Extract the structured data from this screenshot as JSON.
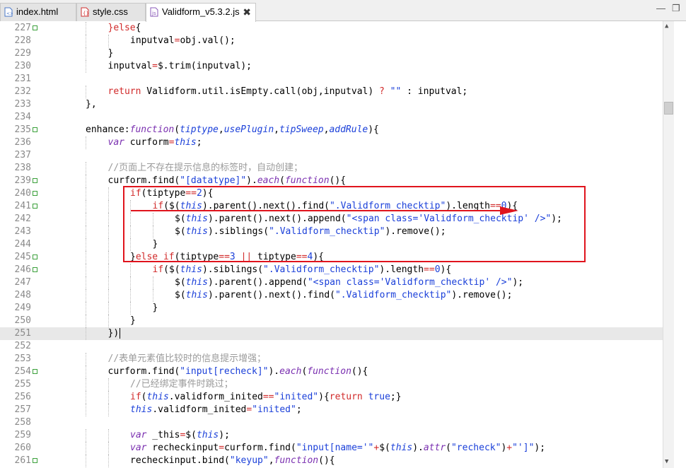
{
  "tabs": [
    {
      "label": "index.html",
      "icon": "html-file-icon"
    },
    {
      "label": "style.css",
      "icon": "css-file-icon"
    },
    {
      "label": "Validform_v5.3.2.js",
      "icon": "js-file-icon",
      "close": "✖"
    }
  ],
  "window_controls": {
    "minimize": "—",
    "restore": "❐"
  },
  "scroll": {
    "up": "▲",
    "down": "▼"
  },
  "lines": [
    {
      "n": "227",
      "fold": true,
      "indent": 3,
      "t": [
        [
          "k",
          "}else"
        ],
        [
          "p",
          "{"
        ]
      ]
    },
    {
      "n": "228",
      "indent": 4,
      "t": [
        [
          "p",
          "inputval"
        ],
        [
          "o",
          "="
        ],
        [
          "p",
          "obj.val();"
        ]
      ]
    },
    {
      "n": "229",
      "indent": 3,
      "t": [
        [
          "p",
          "}"
        ]
      ]
    },
    {
      "n": "230",
      "indent": 3,
      "t": [
        [
          "p",
          "inputval"
        ],
        [
          "o",
          "="
        ],
        [
          "p",
          "$.trim(inputval);"
        ]
      ]
    },
    {
      "n": "231",
      "indent": 0,
      "t": []
    },
    {
      "n": "232",
      "indent": 3,
      "t": [
        [
          "k",
          "return"
        ],
        [
          "p",
          " Validform.util.isEmpty.call(obj,inputval) "
        ],
        [
          "o",
          "?"
        ],
        [
          "p",
          " "
        ],
        [
          "s",
          "\"\""
        ],
        [
          "p",
          " : inputval;"
        ]
      ]
    },
    {
      "n": "233",
      "indent": 2,
      "t": [
        [
          "p",
          "},"
        ]
      ]
    },
    {
      "n": "234",
      "indent": 0,
      "t": []
    },
    {
      "n": "235",
      "fold": true,
      "indent": 2,
      "t": [
        [
          "p",
          "enhance:"
        ],
        [
          "f",
          "function"
        ],
        [
          "p",
          "("
        ],
        [
          "v",
          "tiptype"
        ],
        [
          "p",
          ","
        ],
        [
          "v",
          "usePlugin"
        ],
        [
          "p",
          ","
        ],
        [
          "v",
          "tipSweep"
        ],
        [
          "p",
          ","
        ],
        [
          "v",
          "addRule"
        ],
        [
          "p",
          "){"
        ]
      ]
    },
    {
      "n": "236",
      "indent": 3,
      "t": [
        [
          "f",
          "var"
        ],
        [
          "p",
          " curform"
        ],
        [
          "o",
          "="
        ],
        [
          "v",
          "this"
        ],
        [
          "p",
          ";"
        ]
      ]
    },
    {
      "n": "237",
      "indent": 0,
      "t": []
    },
    {
      "n": "238",
      "indent": 3,
      "t": [
        [
          "c",
          "//页面上不存在提示信息的标签时，自动创建；"
        ]
      ]
    },
    {
      "n": "239",
      "fold": true,
      "indent": 3,
      "t": [
        [
          "p",
          "curform.find("
        ],
        [
          "s",
          "\"[datatype]\""
        ],
        [
          "p",
          ")."
        ],
        [
          "f",
          "each"
        ],
        [
          "p",
          "("
        ],
        [
          "f",
          "function"
        ],
        [
          "p",
          "(){"
        ]
      ]
    },
    {
      "n": "240",
      "fold": true,
      "indent": 4,
      "t": [
        [
          "k",
          "if"
        ],
        [
          "p",
          "(tiptype"
        ],
        [
          "o",
          "=="
        ],
        [
          "n",
          "2"
        ],
        [
          "p",
          "){"
        ]
      ]
    },
    {
      "n": "241",
      "fold": true,
      "indent": 5,
      "t": [
        [
          "k",
          "if"
        ],
        [
          "p",
          "($("
        ],
        [
          "v",
          "this"
        ],
        [
          "p",
          ").parent().next().find("
        ],
        [
          "s",
          "\".Validform_checktip\""
        ],
        [
          "p",
          ").length"
        ],
        [
          "o",
          "=="
        ],
        [
          "n",
          "0"
        ],
        [
          "p",
          "){"
        ]
      ]
    },
    {
      "n": "242",
      "indent": 6,
      "t": [
        [
          "p",
          "$("
        ],
        [
          "v",
          "this"
        ],
        [
          "p",
          ").parent().next().append("
        ],
        [
          "s",
          "\"<span class='Validform_checktip' />\""
        ],
        [
          "p",
          ");"
        ]
      ]
    },
    {
      "n": "243",
      "indent": 6,
      "t": [
        [
          "p",
          "$("
        ],
        [
          "v",
          "this"
        ],
        [
          "p",
          ").siblings("
        ],
        [
          "s",
          "\".Validform_checktip\""
        ],
        [
          "p",
          ").remove();"
        ]
      ]
    },
    {
      "n": "244",
      "indent": 5,
      "t": [
        [
          "p",
          "}"
        ]
      ]
    },
    {
      "n": "245",
      "fold": true,
      "indent": 4,
      "t": [
        [
          "p",
          "}"
        ],
        [
          "k",
          "else if"
        ],
        [
          "p",
          "(tiptype"
        ],
        [
          "o",
          "=="
        ],
        [
          "n",
          "3"
        ],
        [
          "p",
          " "
        ],
        [
          "o",
          "||"
        ],
        [
          "p",
          " tiptype"
        ],
        [
          "o",
          "=="
        ],
        [
          "n",
          "4"
        ],
        [
          "p",
          "){"
        ]
      ]
    },
    {
      "n": "246",
      "fold": true,
      "indent": 5,
      "t": [
        [
          "k",
          "if"
        ],
        [
          "p",
          "($("
        ],
        [
          "v",
          "this"
        ],
        [
          "p",
          ").siblings("
        ],
        [
          "s",
          "\".Validform_checktip\""
        ],
        [
          "p",
          ").length"
        ],
        [
          "o",
          "=="
        ],
        [
          "n",
          "0"
        ],
        [
          "p",
          "){"
        ]
      ]
    },
    {
      "n": "247",
      "indent": 6,
      "t": [
        [
          "p",
          "$("
        ],
        [
          "v",
          "this"
        ],
        [
          "p",
          ").parent().append("
        ],
        [
          "s",
          "\"<span class='Validform_checktip' />\""
        ],
        [
          "p",
          ");"
        ]
      ]
    },
    {
      "n": "248",
      "indent": 6,
      "t": [
        [
          "p",
          "$("
        ],
        [
          "v",
          "this"
        ],
        [
          "p",
          ").parent().next().find("
        ],
        [
          "s",
          "\".Validform_checktip\""
        ],
        [
          "p",
          ").remove();"
        ]
      ]
    },
    {
      "n": "249",
      "indent": 5,
      "t": [
        [
          "p",
          "}"
        ]
      ]
    },
    {
      "n": "250",
      "indent": 4,
      "t": [
        [
          "p",
          "}"
        ]
      ]
    },
    {
      "n": "251",
      "indent": 3,
      "current": true,
      "t": [
        [
          "p",
          "})"
        ]
      ]
    },
    {
      "n": "252",
      "indent": 0,
      "t": []
    },
    {
      "n": "253",
      "indent": 3,
      "t": [
        [
          "c",
          "//表单元素值比较时的信息提示增强；"
        ]
      ]
    },
    {
      "n": "254",
      "fold": true,
      "indent": 3,
      "t": [
        [
          "p",
          "curform.find("
        ],
        [
          "s",
          "\"input[recheck]\""
        ],
        [
          "p",
          ")."
        ],
        [
          "f",
          "each"
        ],
        [
          "p",
          "("
        ],
        [
          "f",
          "function"
        ],
        [
          "p",
          "(){"
        ]
      ]
    },
    {
      "n": "255",
      "indent": 4,
      "t": [
        [
          "c",
          "//已经绑定事件时跳过；"
        ]
      ]
    },
    {
      "n": "256",
      "indent": 4,
      "t": [
        [
          "k",
          "if"
        ],
        [
          "p",
          "("
        ],
        [
          "v",
          "this"
        ],
        [
          "p",
          ".validform_inited"
        ],
        [
          "o",
          "=="
        ],
        [
          "s",
          "\"inited\""
        ],
        [
          "p",
          "){"
        ],
        [
          "k",
          "return"
        ],
        [
          "p",
          " "
        ],
        [
          "n",
          "true"
        ],
        [
          "p",
          ";}"
        ]
      ]
    },
    {
      "n": "257",
      "indent": 4,
      "t": [
        [
          "v",
          "this"
        ],
        [
          "p",
          ".validform_inited"
        ],
        [
          "o",
          "="
        ],
        [
          "s",
          "\"inited\""
        ],
        [
          "p",
          ";"
        ]
      ]
    },
    {
      "n": "258",
      "indent": 0,
      "t": []
    },
    {
      "n": "259",
      "indent": 4,
      "t": [
        [
          "f",
          "var"
        ],
        [
          "p",
          " _this"
        ],
        [
          "o",
          "="
        ],
        [
          "p",
          "$("
        ],
        [
          "v",
          "this"
        ],
        [
          "p",
          ");"
        ]
      ]
    },
    {
      "n": "260",
      "indent": 4,
      "t": [
        [
          "f",
          "var"
        ],
        [
          "p",
          " recheckinput"
        ],
        [
          "o",
          "="
        ],
        [
          "p",
          "curform.find("
        ],
        [
          "s",
          "\"input[name='\""
        ],
        [
          "o",
          "+"
        ],
        [
          "p",
          "$("
        ],
        [
          "v",
          "this"
        ],
        [
          "p",
          ")."
        ],
        [
          "f",
          "attr"
        ],
        [
          "p",
          "("
        ],
        [
          "s",
          "\"recheck\""
        ],
        [
          "p",
          ")"
        ],
        [
          "o",
          "+"
        ],
        [
          "s",
          "\"']\""
        ],
        [
          "p",
          ");"
        ]
      ]
    },
    {
      "n": "261",
      "fold": true,
      "indent": 4,
      "t": [
        [
          "p",
          "recheckinput.bind("
        ],
        [
          "s",
          "\"keyup\""
        ],
        [
          "p",
          ","
        ],
        [
          "f",
          "function"
        ],
        [
          "p",
          "(){"
        ]
      ]
    }
  ]
}
